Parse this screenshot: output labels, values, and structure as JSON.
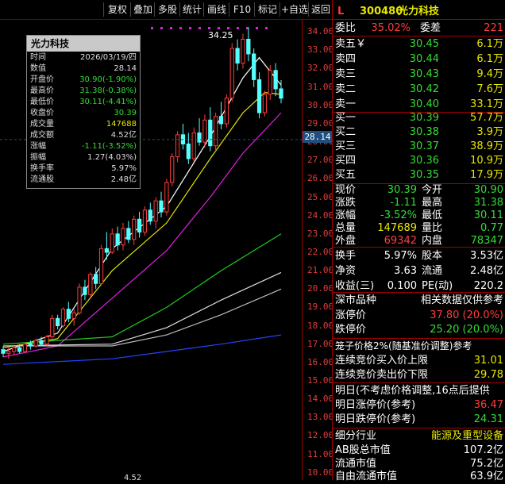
{
  "toolbar": {
    "buttons": [
      "复权",
      "叠加",
      "多股",
      "统计",
      "画线",
      "F10",
      "标记",
      "+自选",
      "返回"
    ]
  },
  "axis": {
    "ticks": [
      "34.00",
      "33.00",
      "32.00",
      "31.00",
      "30.00",
      "29.00",
      "28.00",
      "27.00",
      "26.00",
      "25.00",
      "24.00",
      "23.00",
      "22.00",
      "21.00",
      "20.00",
      "19.00",
      "18.00",
      "17.00",
      "16.00",
      "15.00",
      "14.00",
      "13.00",
      "12.00",
      "11.00",
      "10.00"
    ],
    "current": "28.14",
    "high_label": "34.25",
    "bottom_partial": "4.52"
  },
  "popup": {
    "title": "光力科技",
    "rows": [
      {
        "label": "时间",
        "value": "2026/03/19/四",
        "color": "#dddddd"
      },
      {
        "label": "数值",
        "value": "28.14",
        "color": "#dddddd"
      },
      {
        "label": "开盘价",
        "value": "30.90(-1.90%)",
        "color": "#33dd33"
      },
      {
        "label": "最高价",
        "value": "31.38(-0.38%)",
        "color": "#33dd33"
      },
      {
        "label": "最低价",
        "value": "30.11(-4.41%)",
        "color": "#33dd33"
      },
      {
        "label": "收盘价",
        "value": "30.39",
        "color": "#33dd33"
      },
      {
        "label": "成交量",
        "value": "147688",
        "color": "#e6e600"
      },
      {
        "label": "成交额",
        "value": "4.52亿",
        "color": "#dddddd"
      },
      {
        "label": "涨幅",
        "value": "-1.11(-3.52%)",
        "color": "#33dd33"
      },
      {
        "label": "振幅",
        "value": "1.27(4.03%)",
        "color": "#dddddd"
      },
      {
        "label": "换手率",
        "value": "5.97%",
        "color": "#dddddd"
      },
      {
        "label": "流通股",
        "value": "2.48亿",
        "color": "#dddddd"
      }
    ]
  },
  "panel": {
    "marker": "L",
    "code": "300480",
    "name": "光力科技",
    "weibi_label": "委比",
    "weibi_value": "35.02%",
    "weicha_label": "委差",
    "weicha_value": "221",
    "sell": [
      {
        "label": "卖五￥",
        "price": "30.45",
        "vol": "6.1万"
      },
      {
        "label": "卖四",
        "price": "30.44",
        "vol": "6.1万"
      },
      {
        "label": "卖三",
        "price": "30.43",
        "vol": "9.4万"
      },
      {
        "label": "卖二",
        "price": "30.42",
        "vol": "7.6万"
      },
      {
        "label": "卖一",
        "price": "30.40",
        "vol": "33.1万"
      }
    ],
    "buy": [
      {
        "label": "买一",
        "price": "30.39",
        "vol": "57.7万"
      },
      {
        "label": "买二",
        "price": "30.38",
        "vol": "3.9万"
      },
      {
        "label": "买三",
        "price": "30.37",
        "vol": "38.9万"
      },
      {
        "label": "买四",
        "price": "30.36",
        "vol": "10.9万"
      },
      {
        "label": "买五",
        "price": "30.35",
        "vol": "17.9万"
      }
    ],
    "quote": [
      {
        "l1": "现价",
        "v1": "30.39",
        "c1": "#33dd33",
        "l2": "今开",
        "v2": "30.90",
        "c2": "#33dd33"
      },
      {
        "l1": "涨跌",
        "v1": "-1.11",
        "c1": "#33dd33",
        "l2": "最高",
        "v2": "31.38",
        "c2": "#33dd33"
      },
      {
        "l1": "涨幅",
        "v1": "-3.52%",
        "c1": "#33dd33",
        "l2": "最低",
        "v2": "30.11",
        "c2": "#33dd33"
      },
      {
        "l1": "总量",
        "v1": "147689",
        "c1": "#e6e600",
        "l2": "量比",
        "v2": "0.77",
        "c2": "#33dd33"
      },
      {
        "l1": "外盘",
        "v1": "69342",
        "c1": "#ff4040",
        "l2": "内盘",
        "v2": "78347",
        "c2": "#33dd33"
      }
    ],
    "stats": [
      {
        "l1": "换手",
        "v1": "5.97%",
        "l2": "股本",
        "v2": "3.53亿"
      },
      {
        "l1": "净资",
        "v1": "3.63",
        "l2": "流通",
        "v2": "2.48亿"
      },
      {
        "l1": "收益(三)",
        "v1": "0.100",
        "l2": "PE(动)",
        "v2": "220.2"
      }
    ],
    "deep_label": "深市品种",
    "deep_note": "相关数据仅供参考",
    "limit_up_label": "涨停价",
    "limit_up_value": "37.80 (20.0%)",
    "limit_down_label": "跌停价",
    "limit_down_value": "25.20 (20.0%)",
    "cage_title": "笼子价格2%(随基准价调整)参考",
    "auction_buy_label": "连续竞价买入价上限",
    "auction_buy_value": "31.01",
    "auction_sell_label": "连续竞价卖出价下限",
    "auction_sell_value": "29.78",
    "tomorrow_note": "明日(不考虑价格调整,16点后提供",
    "tomorrow_up_label": "明日涨停价(参考)",
    "tomorrow_up_value": "36.47",
    "tomorrow_down_label": "明日跌停价(参考)",
    "tomorrow_down_value": "24.31",
    "industry_label": "细分行业",
    "industry_value": "能源及重型设备",
    "ab_label": "AB股总市值",
    "ab_value": "107.2亿",
    "float_label": "流通市值",
    "float_value": "75.2亿",
    "free_label": "自由流通市值",
    "free_value": "63.9亿"
  },
  "colors": {
    "up": "#ff3c3c",
    "down": "#54ffff",
    "green": "#33dd33",
    "yellow": "#e6e600",
    "panel_border": "#a00000"
  },
  "chart_data": {
    "type": "candlestick",
    "ylim": [
      9.6,
      34.7
    ],
    "candles": [
      [
        16.7,
        16.9,
        16.3,
        16.5
      ],
      [
        16.5,
        16.8,
        16.2,
        16.6
      ],
      [
        16.6,
        16.9,
        16.4,
        16.8
      ],
      [
        16.8,
        17.0,
        16.5,
        16.6
      ],
      [
        16.6,
        17.1,
        16.5,
        17.0
      ],
      [
        17.0,
        17.2,
        16.7,
        16.9
      ],
      [
        16.9,
        17.3,
        16.8,
        17.2
      ],
      [
        17.2,
        17.4,
        16.9,
        17.0
      ],
      [
        17.0,
        17.5,
        16.9,
        17.4
      ],
      [
        17.4,
        18.6,
        17.3,
        18.4
      ],
      [
        18.4,
        18.6,
        17.8,
        18.0
      ],
      [
        18.0,
        19.0,
        17.9,
        18.9
      ],
      [
        18.9,
        19.3,
        18.2,
        18.4
      ],
      [
        18.4,
        18.9,
        18.0,
        18.7
      ],
      [
        18.7,
        20.3,
        18.6,
        20.1
      ],
      [
        20.1,
        20.5,
        19.4,
        19.7
      ],
      [
        19.7,
        20.9,
        19.6,
        20.8
      ],
      [
        20.8,
        21.2,
        20.0,
        20.3
      ],
      [
        20.3,
        22.4,
        20.2,
        22.2
      ],
      [
        22.2,
        23.1,
        21.6,
        22.0
      ],
      [
        22.0,
        23.3,
        21.9,
        23.0
      ],
      [
        23.0,
        23.4,
        22.1,
        22.4
      ],
      [
        22.4,
        23.6,
        22.1,
        23.3
      ],
      [
        23.3,
        23.7,
        22.5,
        22.7
      ],
      [
        22.7,
        24.0,
        22.4,
        23.8
      ],
      [
        23.8,
        24.2,
        22.8,
        23.1
      ],
      [
        23.1,
        24.5,
        22.9,
        24.3
      ],
      [
        24.3,
        24.7,
        23.5,
        23.7
      ],
      [
        23.7,
        25.0,
        23.3,
        24.8
      ],
      [
        24.8,
        25.3,
        23.9,
        24.2
      ],
      [
        24.2,
        26.0,
        24.0,
        25.8
      ],
      [
        25.8,
        27.4,
        25.6,
        27.2
      ],
      [
        27.2,
        28.6,
        26.9,
        28.4
      ],
      [
        28.4,
        29.0,
        27.6,
        27.9
      ],
      [
        27.9,
        28.5,
        26.8,
        27.1
      ],
      [
        27.1,
        28.8,
        26.9,
        28.5
      ],
      [
        28.5,
        29.3,
        27.8,
        28.0
      ],
      [
        28.0,
        29.5,
        27.7,
        29.2
      ],
      [
        29.2,
        29.9,
        27.5,
        27.8
      ],
      [
        27.8,
        29.6,
        27.5,
        29.4
      ],
      [
        29.4,
        30.2,
        28.7,
        29.0
      ],
      [
        29.0,
        30.6,
        28.8,
        30.4
      ],
      [
        30.4,
        33.4,
        30.2,
        33.1
      ],
      [
        33.1,
        33.6,
        31.9,
        32.3
      ],
      [
        32.3,
        33.9,
        32.0,
        33.6
      ],
      [
        33.6,
        34.25,
        32.4,
        32.8
      ],
      [
        32.8,
        33.1,
        31.0,
        31.4
      ],
      [
        31.4,
        31.8,
        29.3,
        29.6
      ],
      [
        29.6,
        30.8,
        29.4,
        30.6
      ],
      [
        30.6,
        32.2,
        30.3,
        31.9
      ],
      [
        31.9,
        32.3,
        30.5,
        30.9
      ],
      [
        30.9,
        31.38,
        30.11,
        30.39
      ]
    ],
    "ma": [
      {
        "name": "MA5",
        "color": "#ffffff",
        "points": [
          [
            0,
            16.6
          ],
          [
            10,
            17.6
          ],
          [
            20,
            22.2
          ],
          [
            30,
            24.5
          ],
          [
            38,
            28.3
          ],
          [
            44,
            31.5
          ],
          [
            47,
            32.6
          ],
          [
            51,
            31.1
          ]
        ]
      },
      {
        "name": "MA10",
        "color": "#e6e600",
        "points": [
          [
            0,
            16.8
          ],
          [
            10,
            17.3
          ],
          [
            20,
            21.0
          ],
          [
            30,
            23.6
          ],
          [
            38,
            27.1
          ],
          [
            44,
            29.6
          ],
          [
            48,
            30.7
          ],
          [
            51,
            30.6
          ]
        ]
      },
      {
        "name": "MA20",
        "color": "#e020e0",
        "points": [
          [
            0,
            16.3
          ],
          [
            10,
            16.9
          ],
          [
            20,
            19.5
          ],
          [
            30,
            22.1
          ],
          [
            38,
            25.0
          ],
          [
            44,
            27.4
          ],
          [
            51,
            29.6
          ]
        ]
      },
      {
        "name": "MA30",
        "color": "#22cc22",
        "points": [
          [
            0,
            17.0
          ],
          [
            20,
            17.4
          ],
          [
            30,
            19.0
          ],
          [
            40,
            21.0
          ],
          [
            51,
            23.0
          ]
        ]
      },
      {
        "name": "MA60",
        "color": "#dddddd",
        "points": [
          [
            0,
            16.9
          ],
          [
            20,
            17.0
          ],
          [
            30,
            17.9
          ],
          [
            40,
            19.4
          ],
          [
            51,
            20.9
          ]
        ]
      },
      {
        "name": "MA90",
        "color": "#bbbbbb",
        "points": [
          [
            0,
            16.9
          ],
          [
            20,
            16.9
          ],
          [
            30,
            17.5
          ],
          [
            40,
            18.6
          ],
          [
            51,
            20.0
          ]
        ]
      },
      {
        "name": "MA120",
        "color": "#2244ff",
        "points": [
          [
            0,
            15.9
          ],
          [
            20,
            16.2
          ],
          [
            30,
            16.6
          ],
          [
            40,
            17.0
          ],
          [
            51,
            17.5
          ]
        ]
      }
    ]
  }
}
